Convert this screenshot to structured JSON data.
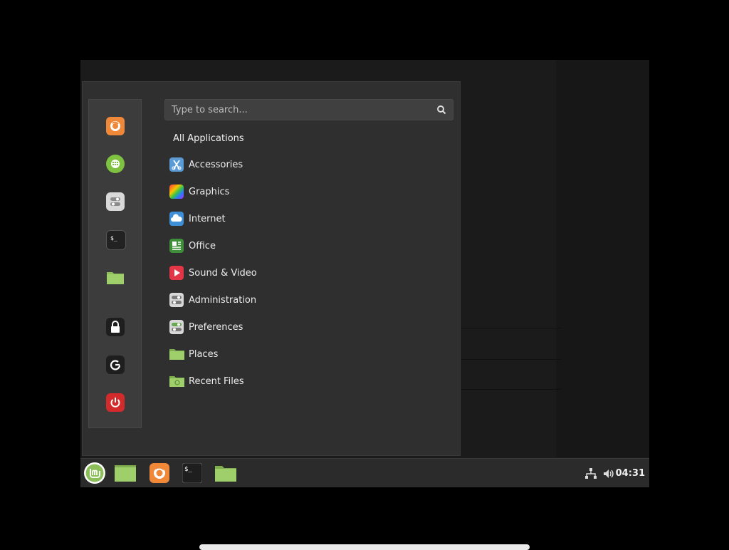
{
  "search": {
    "placeholder": "Type to search..."
  },
  "menu": {
    "all_apps_label": "All Applications",
    "categories": [
      {
        "label": "Accessories",
        "icon": "accessories-icon",
        "color": "#5b9bd5"
      },
      {
        "label": "Graphics",
        "icon": "graphics-icon",
        "color": "#c23fcf"
      },
      {
        "label": "Internet",
        "icon": "internet-icon",
        "color": "#3d8fd8"
      },
      {
        "label": "Office",
        "icon": "office-icon",
        "color": "#3f8f3a"
      },
      {
        "label": "Sound & Video",
        "icon": "sound-video-icon",
        "color": "#e23545"
      },
      {
        "label": "Administration",
        "icon": "administration-icon",
        "color": "#d8d8d8"
      },
      {
        "label": "Preferences",
        "icon": "preferences-icon",
        "color": "#d8d8d8"
      },
      {
        "label": "Places",
        "icon": "places-folder-icon",
        "color": "#8cbf5a"
      },
      {
        "label": "Recent Files",
        "icon": "recent-files-folder-icon",
        "color": "#8cbf5a"
      }
    ]
  },
  "favorites": [
    {
      "name": "firefox-icon",
      "color": "#f0883a"
    },
    {
      "name": "software-manager-icon",
      "color": "#7fc241"
    },
    {
      "name": "system-settings-icon",
      "color": "#d9d9d9"
    },
    {
      "name": "terminal-icon",
      "color": "#222222"
    },
    {
      "name": "files-icon",
      "color": "#8cbf5a"
    },
    {
      "name": "lock-screen-icon",
      "color": "#1e1e1e"
    },
    {
      "name": "logout-icon",
      "color": "#1e1e1e"
    },
    {
      "name": "power-off-icon",
      "color": "#d32b2b"
    }
  ],
  "panel": {
    "clock": "04:31",
    "launchers": [
      "menu-button",
      "show-desktop",
      "firefox",
      "terminal",
      "files"
    ]
  },
  "colors": {
    "accent": "#8cbf5a",
    "menu_bg": "#2f2f2f",
    "panel_bg": "#2b2b2b"
  }
}
